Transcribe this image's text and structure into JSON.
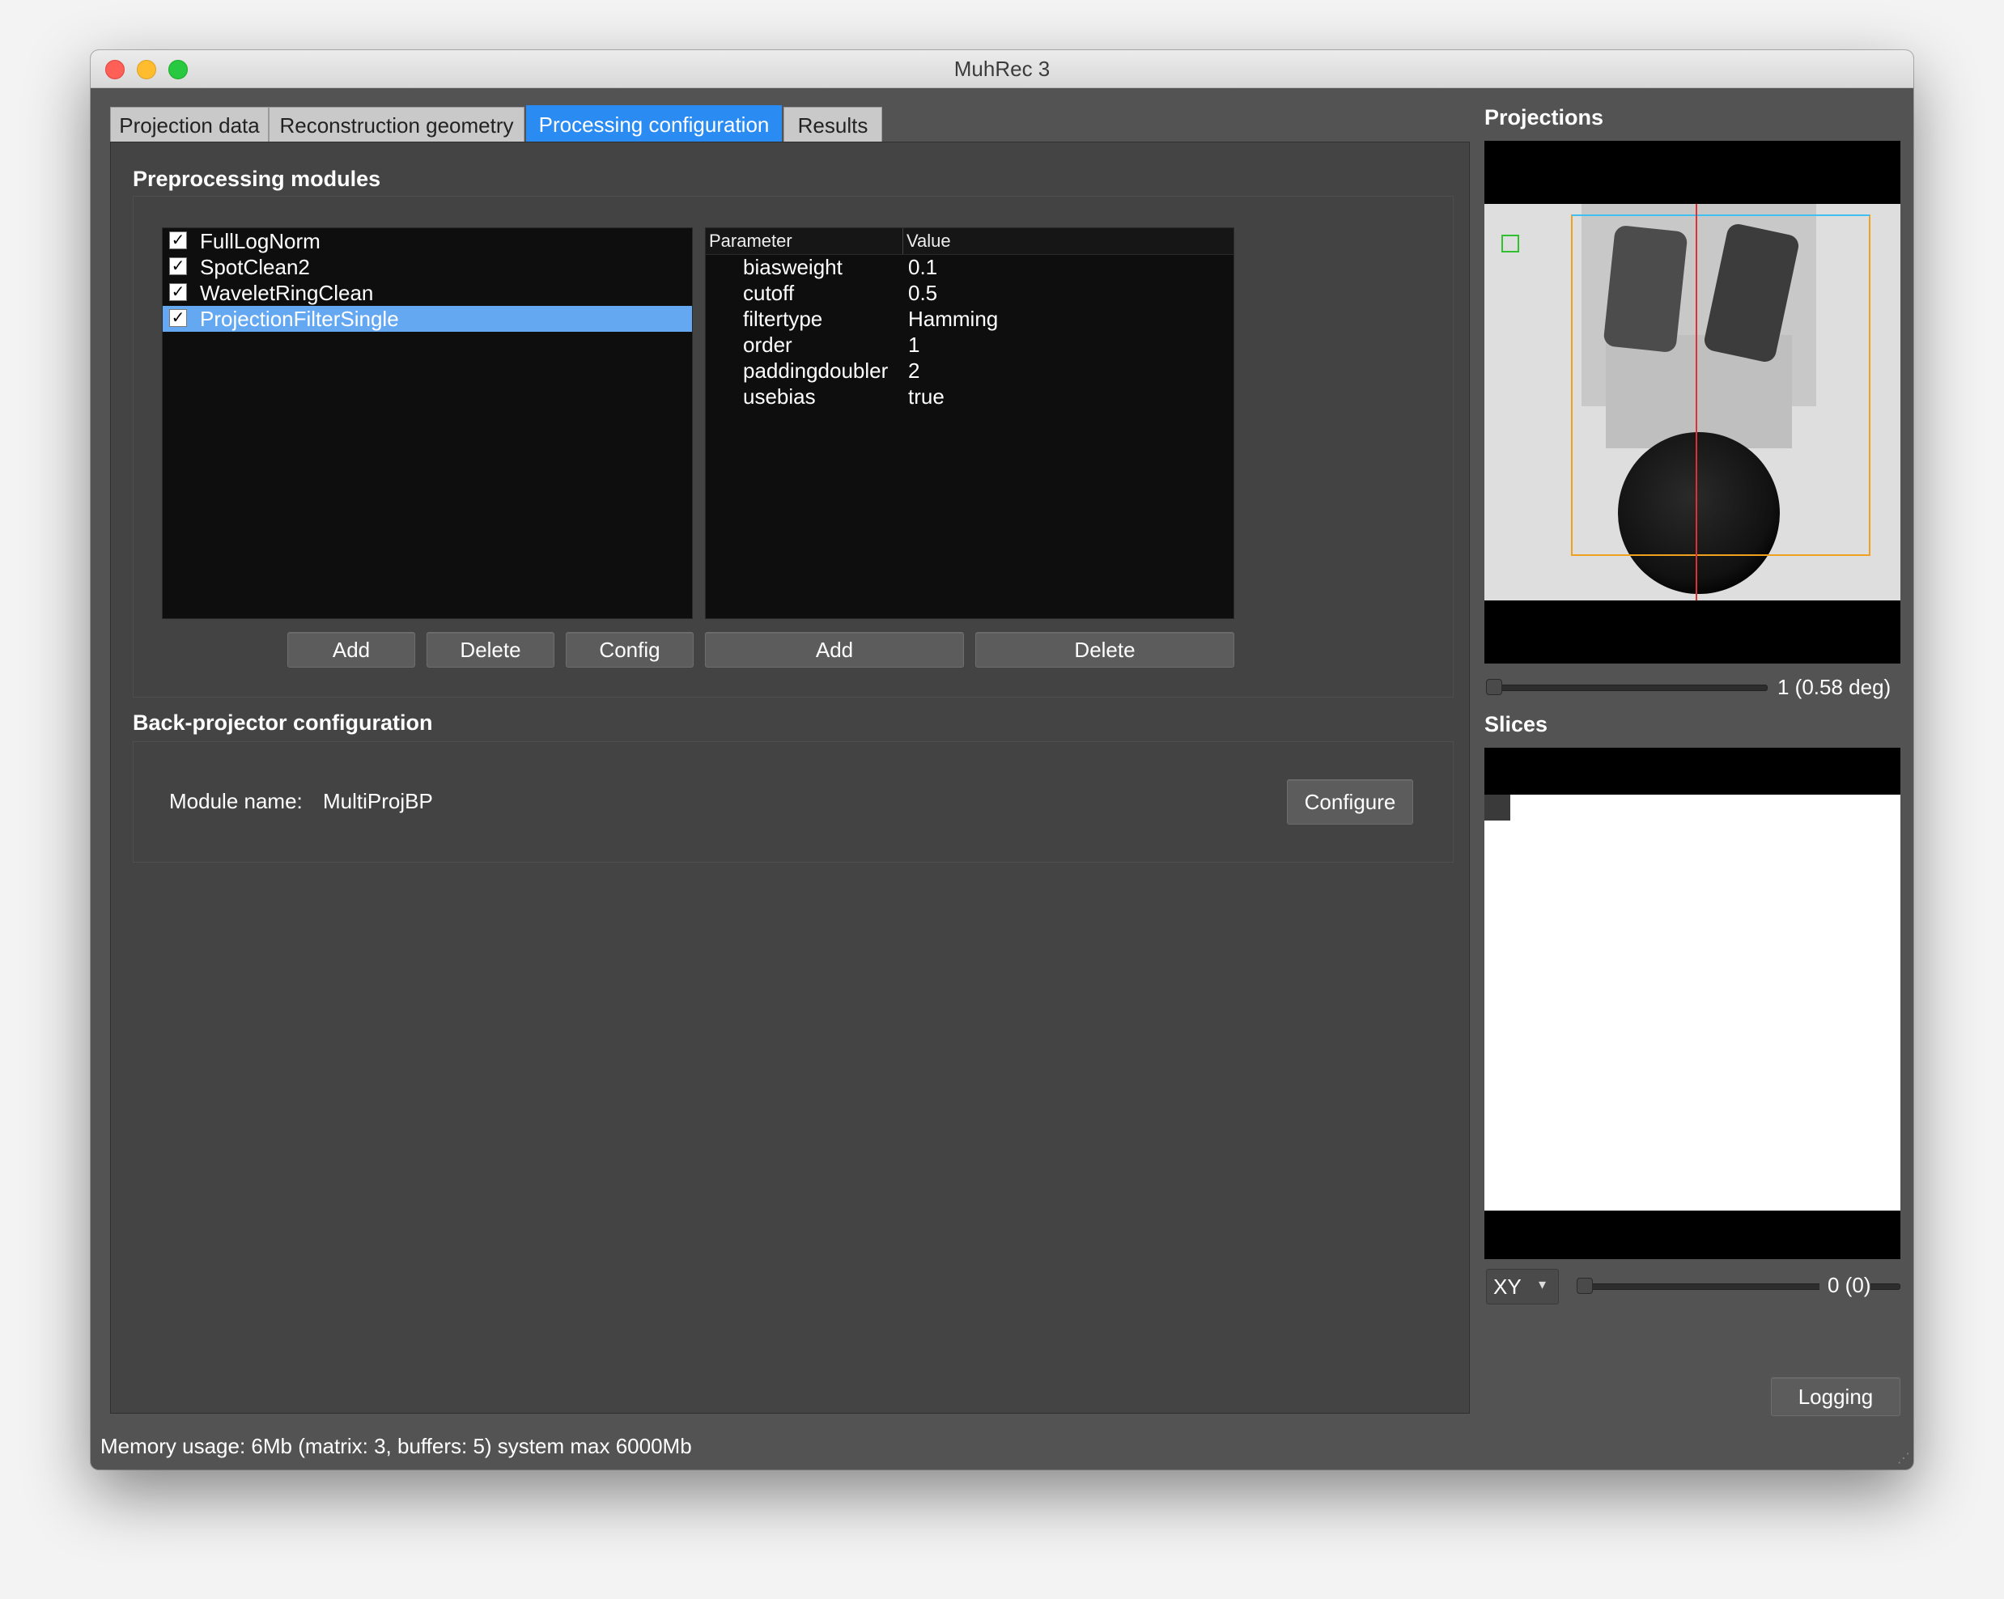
{
  "window": {
    "title": "MuhRec 3"
  },
  "tabs": [
    {
      "label": "Projection data"
    },
    {
      "label": "Reconstruction geometry"
    },
    {
      "label": "Processing configuration"
    },
    {
      "label": "Results"
    }
  ],
  "preprocessing": {
    "title": "Preprocessing modules",
    "modules": [
      {
        "label": "FullLogNorm",
        "checked": true
      },
      {
        "label": "SpotClean2",
        "checked": true
      },
      {
        "label": "WaveletRingClean",
        "checked": true
      },
      {
        "label": "ProjectionFilterSingle",
        "checked": true,
        "selected": true
      }
    ],
    "params_header": {
      "parameter": "Parameter",
      "value": "Value"
    },
    "params": [
      {
        "name": "biasweight",
        "value": "0.1"
      },
      {
        "name": "cutoff",
        "value": "0.5"
      },
      {
        "name": "filtertype",
        "value": "Hamming"
      },
      {
        "name": "order",
        "value": "1"
      },
      {
        "name": "paddingdoubler",
        "value": "2"
      },
      {
        "name": "usebias",
        "value": "true"
      }
    ],
    "buttons": {
      "add": "Add",
      "delete": "Delete",
      "config": "Config",
      "param_add": "Add",
      "param_delete": "Delete"
    }
  },
  "backprojector": {
    "title": "Back-projector configuration",
    "module_label": "Module name:",
    "module_name": "MultiProjBP",
    "configure": "Configure"
  },
  "projections": {
    "title": "Projections",
    "slider_value": "1 (0.58 deg)"
  },
  "slices": {
    "title": "Slices",
    "plane": "XY",
    "slider_value": "0 (0)"
  },
  "logging": "Logging",
  "status": "Memory usage: 6Mb (matrix: 3, buffers: 5) system max 6000Mb",
  "colors": {
    "accent": "#2a8cf2",
    "selection": "#64a8f2",
    "roi_orange": "#f0a020",
    "roi_cyan": "#40c0f0",
    "marker_red": "#e03030",
    "marker_green": "#30c030"
  }
}
